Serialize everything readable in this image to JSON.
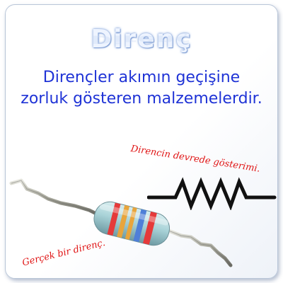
{
  "title": "Direnç",
  "definition": "Dirençler akımın geçişine zorluk gösteren malzemelerdir.",
  "notes": {
    "circuit_symbol": "Direncin devrede gösterimi.",
    "real_resistor": "Gerçek bir direnç."
  },
  "icons": {
    "circuit_symbol": "resistor-zigzag-icon",
    "photo": "resistor-photo"
  },
  "colors": {
    "title": "#eef4ff",
    "definition": "#1f33d6",
    "notes": "#e01515",
    "symbol": "#111111",
    "resistor_body": "#a9d3d8",
    "band_red": "#e53a3a",
    "band_yellow": "#e8a53c",
    "band_blue": "#4f7fd8"
  }
}
